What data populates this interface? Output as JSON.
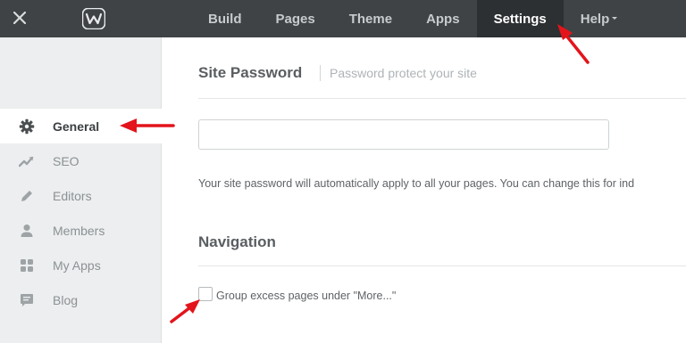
{
  "topbar": {
    "nav": [
      {
        "label": "Build",
        "active": false
      },
      {
        "label": "Pages",
        "active": false
      },
      {
        "label": "Theme",
        "active": false
      },
      {
        "label": "Apps",
        "active": false
      },
      {
        "label": "Settings",
        "active": true
      },
      {
        "label": "Help",
        "active": false,
        "has_caret": true
      }
    ],
    "close_icon": "close-icon",
    "logo_icon": "weebly-logo"
  },
  "sidebar": {
    "items": [
      {
        "label": "General",
        "icon": "gear-icon",
        "active": true
      },
      {
        "label": "SEO",
        "icon": "trend-line-icon",
        "active": false
      },
      {
        "label": "Editors",
        "icon": "pencil-icon",
        "active": false
      },
      {
        "label": "Members",
        "icon": "person-icon",
        "active": false
      },
      {
        "label": "My Apps",
        "icon": "apps-grid-icon",
        "active": false
      },
      {
        "label": "Blog",
        "icon": "speech-bubble-icon",
        "active": false
      }
    ]
  },
  "main": {
    "password_section": {
      "title": "Site Password",
      "subtitle": "Password protect your site",
      "input_value": "",
      "help_text": "Your site password will automatically apply to all your pages. You can change this for ind"
    },
    "navigation_section": {
      "title": "Navigation",
      "checkbox_label": "Group excess pages under \"More...\"",
      "checkbox_checked": false
    }
  },
  "colors": {
    "topbar_bg": "#3f4345",
    "active_nav_bg": "#2d3032",
    "sidebar_bg": "#eceeef",
    "annotation_arrow": "#e3141b"
  }
}
